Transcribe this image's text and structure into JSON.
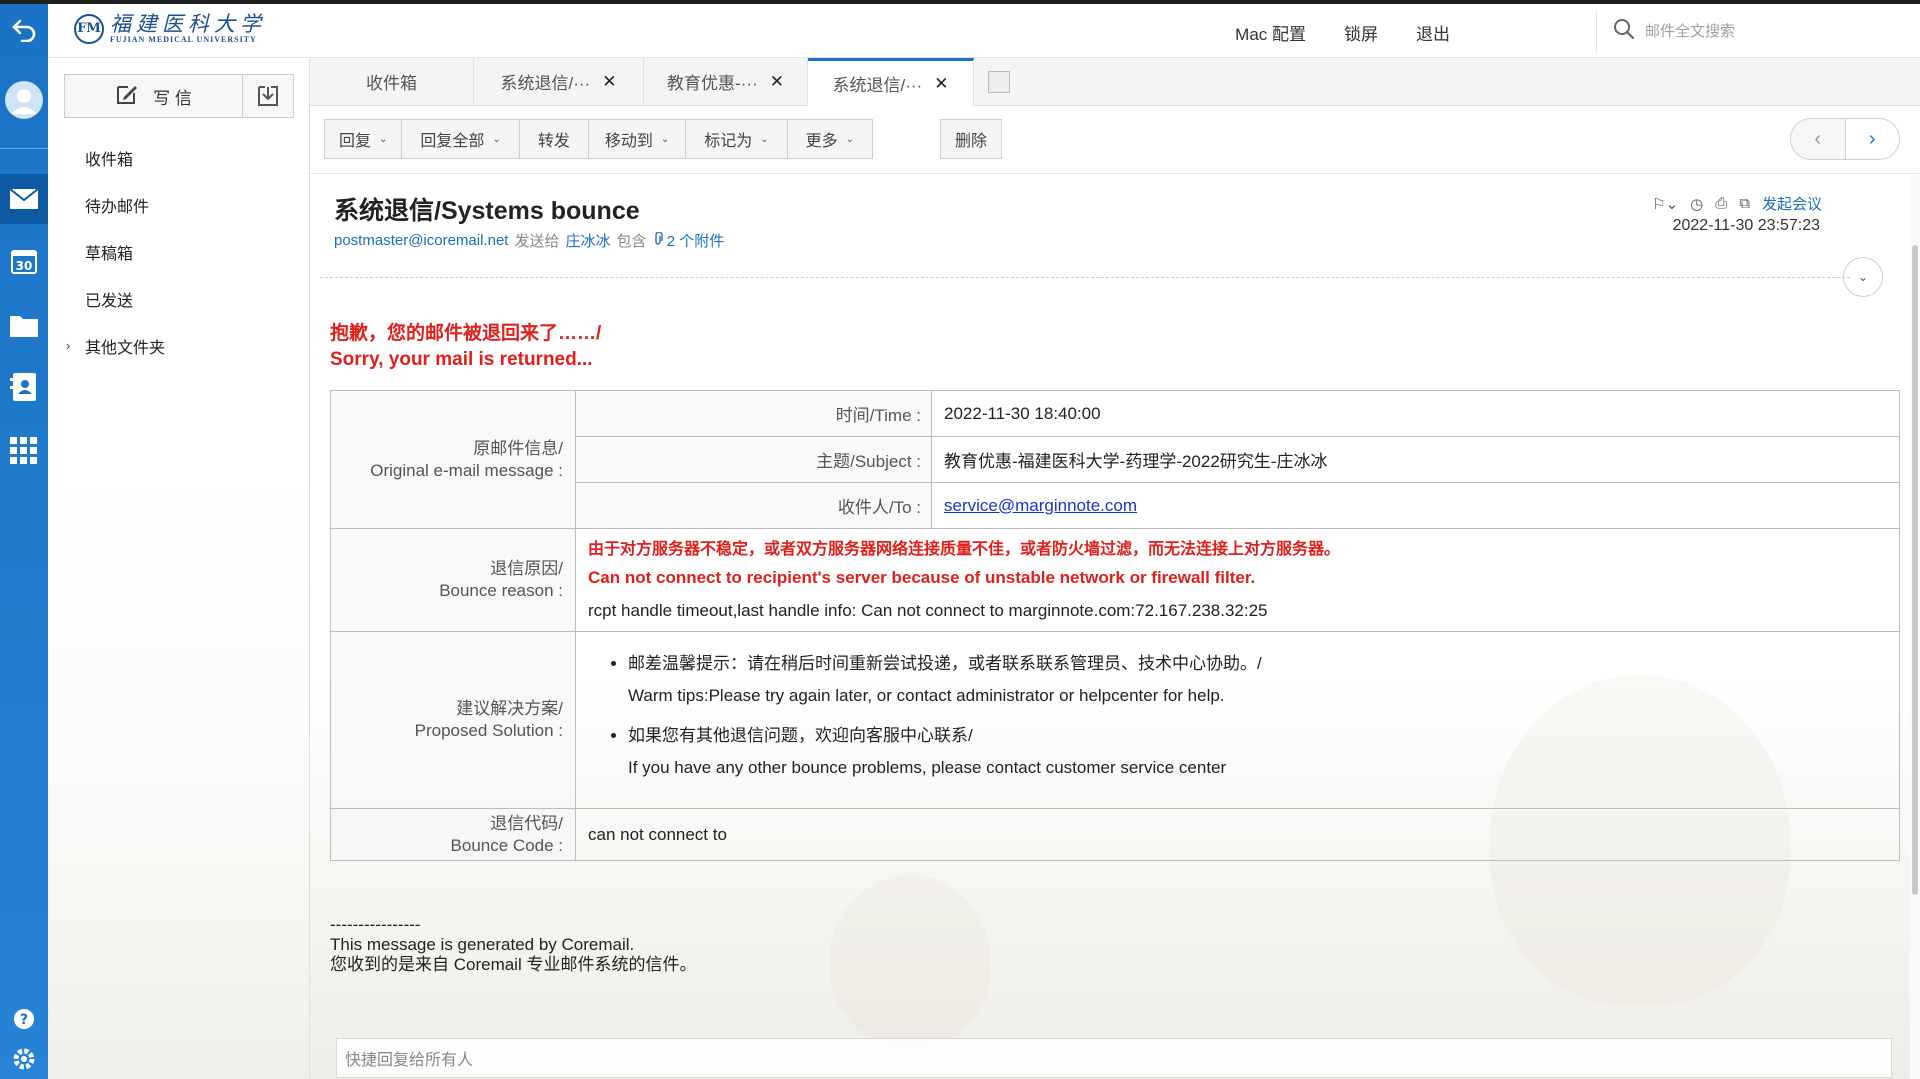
{
  "header": {
    "logo_cn": "福建医科大学",
    "logo_en": "FUJIAN MEDICAL UNIVERSITY",
    "links": [
      "Mac 配置",
      "锁屏",
      "退出"
    ],
    "search_placeholder": "邮件全文搜索"
  },
  "folders": {
    "compose_label": "写 信",
    "items": [
      "收件箱",
      "待办邮件",
      "草稿箱",
      "已发送",
      "其他文件夹"
    ]
  },
  "tabs": [
    {
      "label": "收件箱",
      "closable": false
    },
    {
      "label": "系统退信/···",
      "closable": true
    },
    {
      "label": "教育优惠-···",
      "closable": true
    },
    {
      "label": "系统退信/···",
      "closable": true,
      "active": true
    }
  ],
  "toolbar": {
    "reply": "回复",
    "reply_all": "回复全部",
    "forward": "转发",
    "move_to": "移动到",
    "mark_as": "标记为",
    "more": "更多",
    "delete": "删除"
  },
  "mail": {
    "subject": "系统退信/Systems bounce",
    "from": "postmaster@icoremail.net",
    "sent_to_label": "发送给",
    "to": "庄冰冰",
    "contains_label": "包含",
    "attachments": "2 个附件",
    "meeting_label": "发起会议",
    "date": "2022-11-30 23:57:23"
  },
  "body": {
    "sorry_cn": "抱歉，您的邮件被退回来了……/",
    "sorry_en": "Sorry, your mail is returned...",
    "original": {
      "label_cn": "原邮件信息/",
      "label_en": "Original e-mail message :",
      "time_label": "时间/Time :",
      "time_value": "2022-11-30 18:40:00",
      "subject_label": "主题/Subject :",
      "subject_value": "教育优惠-福建医科大学-药理学-2022研究生-庄冰冰",
      "to_label": "收件人/To :",
      "to_value": "service@marginnote.com"
    },
    "reason": {
      "label_cn": "退信原因/",
      "label_en": "Bounce reason :",
      "cn": "由于对方服务器不稳定，或者双方服务器网络连接质量不佳，或者防火墙过滤，而无法连接上对方服务器。",
      "en": "Can not connect to recipient's server because of unstable network or firewall filter.",
      "info": "rcpt handle timeout,last handle info: Can not connect to marginnote.com:72.167.238.32:25"
    },
    "solution": {
      "label_cn": "建议解决方案/",
      "label_en": "Proposed Solution :",
      "tip1_cn": "邮差温馨提示：请在稍后时间重新尝试投递，或者联系联系管理员、技术中心协助。/",
      "tip1_en": "Warm tips:Please try again later, or contact administrator or helpcenter for help.",
      "tip2_cn": "如果您有其他退信问题，欢迎向客服中心联系/",
      "tip2_en": "If you have any other bounce problems, please contact customer service center"
    },
    "code": {
      "label_cn": "退信代码/",
      "label_en": "Bounce Code :",
      "value": "can not connect to"
    },
    "footer_dashes": "----------------",
    "footer_en": "This message is generated by Coremail.",
    "footer_cn": "您收到的是来自 Coremail 专业邮件系统的信件。",
    "quick_reply_placeholder": "快捷回复给所有人"
  },
  "colors": {
    "rail": "#1a73c4",
    "link": "#1a6fc4",
    "error_red": "#e0201b"
  }
}
